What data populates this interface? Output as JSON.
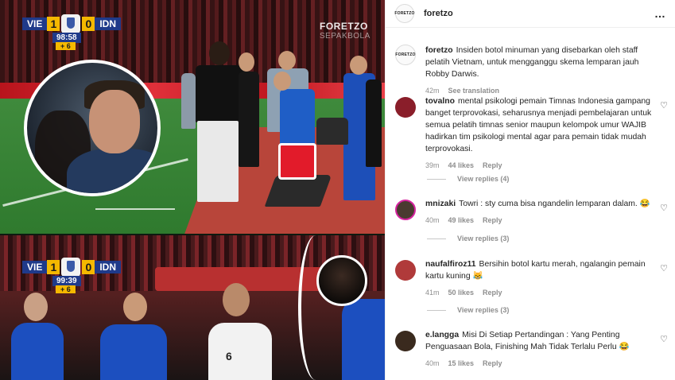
{
  "media": {
    "top_clip": {
      "home_team": "VIE",
      "home_score": "1",
      "away_team": "IDN",
      "away_score": "0",
      "clock": "98:58",
      "added_time": "+ 6",
      "watermark": "FORETZO",
      "watermark_sub": "SEPAKBOLA"
    },
    "bottom_clip": {
      "home_team": "VIE",
      "home_score": "1",
      "away_team": "IDN",
      "away_score": "0",
      "clock": "99:39",
      "added_time": "+ 6",
      "jersey_number": "6"
    }
  },
  "panel": {
    "header": {
      "avatar_text": "FORETZO",
      "username": "foretzo",
      "more_icon": "…"
    },
    "caption": {
      "username": "foretzo",
      "text": "Insiden botol minuman yang disebarkan oleh staff pelatih Vietnam, untuk mengganggu skema lemparan jauh Robby Darwis.",
      "time": "42m",
      "translate": "See translation"
    },
    "comments": [
      {
        "username": "tovalno",
        "text": "mental psikologi pemain Timnas Indonesia gampang banget terprovokasi, seharusnya menjadi pembelajaran untuk semua pelatih timnas senior maupun kelompok umur WAJIB hadirkan tim psikologi mental agar para pemain tidak mudah terprovokasi.",
        "time": "39m",
        "likes": "44 likes",
        "reply": "Reply",
        "view_replies": "View replies (4)",
        "avatar_color": "#8a1e2a"
      },
      {
        "username": "mnizaki",
        "text": "Towri : sty cuma bisa ngandelin lemparan dalam. 😂",
        "time": "40m",
        "likes": "49 likes",
        "reply": "Reply",
        "view_replies": "View replies (3)",
        "avatar_color": "#4a3a30"
      },
      {
        "username": "naufalfiroz11",
        "text": "Bersihin botol kartu merah, ngalangin pemain kartu kuning 😹",
        "time": "41m",
        "likes": "50 likes",
        "reply": "Reply",
        "view_replies": "View replies (3)",
        "avatar_color": "#b03a3a"
      },
      {
        "username": "e.langga",
        "text": "Misi Di Setiap Pertandingan : Yang Penting Penguasaan Bola, Finishing Mah Tidak Terlalu Perlu 😂",
        "time": "40m",
        "likes": "15 likes",
        "reply": "Reply",
        "avatar_color": "#3a2a1e"
      }
    ],
    "heart_icon": "♡"
  }
}
